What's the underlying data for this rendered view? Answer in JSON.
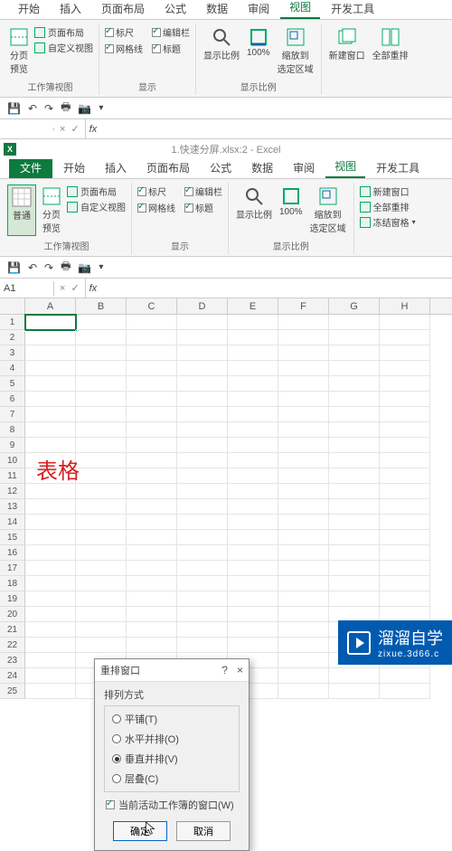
{
  "window1": {
    "tabs": [
      "开始",
      "插入",
      "页面布局",
      "公式",
      "数据",
      "审阅",
      "视图",
      "开发工具"
    ],
    "active_tab": "视图",
    "ribbon": {
      "group1": {
        "btn1": "分页\n预览",
        "btn2": "页面布局",
        "btn3": "自定义视图",
        "label": "工作簿视图"
      },
      "group2": {
        "chk_ruler": "标尺",
        "chk_grid": "网格线",
        "chk_formula": "编辑栏",
        "chk_heading": "标题",
        "label": "显示"
      },
      "group3": {
        "btn_zoom": "显示比例",
        "btn_100": "100%",
        "btn_sel": "缩放到\n选定区域",
        "label": "显示比例"
      },
      "group4": {
        "btn_new": "新建窗口",
        "btn_all": "全部重排"
      }
    },
    "qat_icons": [
      "save",
      "undo",
      "redo",
      "print",
      "camera"
    ]
  },
  "formula_bar1": {
    "fx": "fx"
  },
  "title2": "1.快速分屏.xlsx:2 - Excel",
  "window2": {
    "file_tab": "文件",
    "tabs": [
      "开始",
      "插入",
      "页面布局",
      "公式",
      "数据",
      "审阅",
      "视图",
      "开发工具"
    ],
    "active_tab": "视图",
    "ribbon": {
      "group1": {
        "btn_normal": "普通",
        "btn_page": "分页\n预览",
        "btn_layout": "页面布局",
        "btn_custom": "自定义视图",
        "label": "工作簿视图"
      },
      "group2": {
        "chk_ruler": "标尺",
        "chk_grid": "网格线",
        "chk_formula": "编辑栏",
        "chk_heading": "标题",
        "label": "显示"
      },
      "group3": {
        "btn_zoom": "显示比例",
        "btn_100": "100%",
        "btn_sel": "缩放到\n选定区域",
        "label": "显示比例"
      },
      "group4": {
        "btn_new": "新建窗口",
        "btn_all": "全部重排",
        "btn_freeze": "冻结窗格"
      }
    }
  },
  "cell_ref": "A1",
  "columns": [
    "A",
    "B",
    "C",
    "D",
    "E",
    "F",
    "G",
    "H"
  ],
  "row_count": 25,
  "red_text": "表格",
  "dialog": {
    "title": "重排窗口",
    "help": "?",
    "close": "×",
    "section": "排列方式",
    "opt_tile": "平铺(T)",
    "opt_horiz": "水平并排(O)",
    "opt_vert": "垂直并排(V)",
    "opt_cascade": "层叠(C)",
    "selected": "opt_vert",
    "chk_active": "当前活动工作簿的窗口(W)",
    "chk_active_checked": true,
    "btn_ok": "确定",
    "btn_cancel": "取消"
  },
  "watermark": {
    "brand": "溜溜自学",
    "url": "zixue.3d66.c"
  }
}
